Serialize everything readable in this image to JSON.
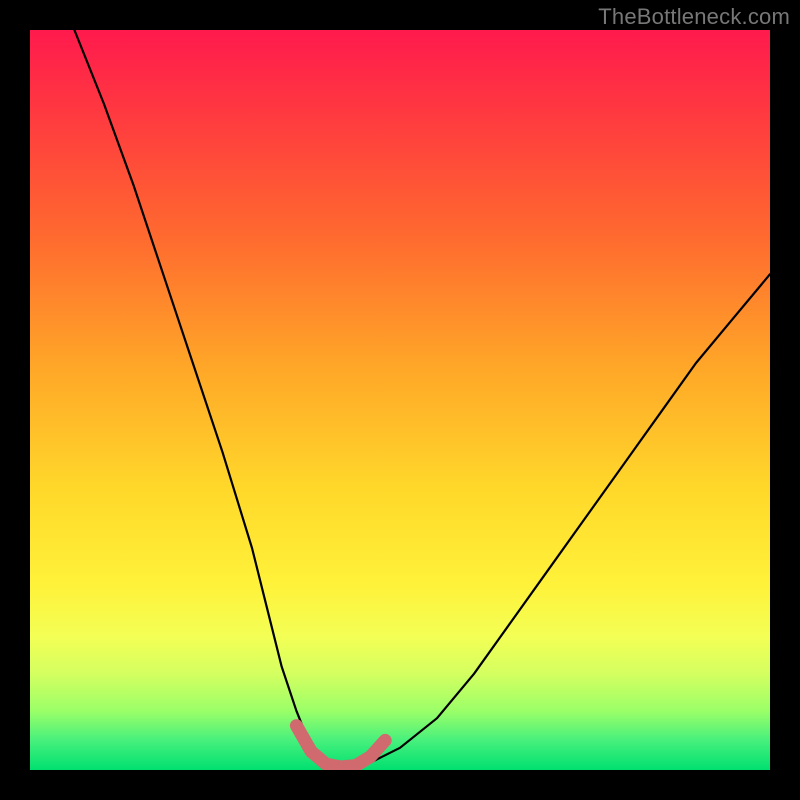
{
  "watermark": "TheBottleneck.com",
  "chart_data": {
    "type": "line",
    "title": "",
    "xlabel": "",
    "ylabel": "",
    "xlim": [
      0,
      100
    ],
    "ylim": [
      0,
      100
    ],
    "legend": false,
    "grid": false,
    "background": "red-to-green vertical gradient",
    "series": [
      {
        "name": "bottleneck-curve",
        "color": "#000000",
        "x": [
          6,
          10,
          14,
          18,
          22,
          26,
          30,
          32,
          34,
          36,
          38,
          40,
          42,
          44,
          46,
          50,
          55,
          60,
          65,
          70,
          75,
          80,
          85,
          90,
          95,
          100
        ],
        "y": [
          100,
          90,
          79,
          67,
          55,
          43,
          30,
          22,
          14,
          8,
          3,
          1,
          0,
          0,
          1,
          3,
          7,
          13,
          20,
          27,
          34,
          41,
          48,
          55,
          61,
          67
        ]
      },
      {
        "name": "optimal-region-marker",
        "color": "#d16a6f",
        "x": [
          36,
          38,
          40,
          42,
          44,
          46,
          48
        ],
        "y": [
          6,
          2.5,
          0.8,
          0.4,
          0.6,
          1.8,
          4
        ]
      }
    ],
    "annotations": []
  }
}
